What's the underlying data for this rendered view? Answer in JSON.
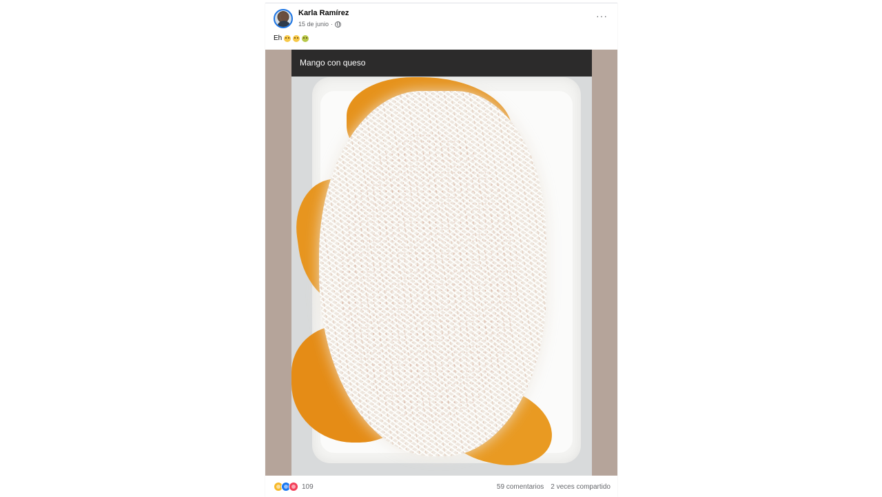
{
  "post": {
    "author": "Karla Ramírez",
    "date": "15 de junio",
    "date_separator": "·",
    "caption_text": "Eh",
    "caption_emojis": [
      "grinning-face-emoji",
      "sweat-smile-emoji",
      "nauseated-face-emoji"
    ],
    "more_icon": "···",
    "privacy_icon": "globe-icon"
  },
  "photo": {
    "title": "Mango con queso",
    "background_color": "#b5a49a",
    "title_bar_color": "#2c2b2b"
  },
  "footer": {
    "reaction_icons": [
      "haha-reaction-icon",
      "like-reaction-icon",
      "love-reaction-icon"
    ],
    "reaction_count": "109",
    "comments": "59 comentarios",
    "shares": "2 veces compartido"
  },
  "colors": {
    "accent": "#1877f2",
    "text_secondary": "#65676b"
  }
}
